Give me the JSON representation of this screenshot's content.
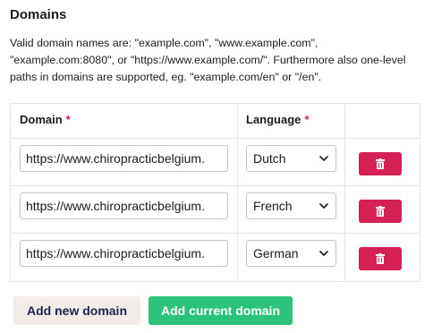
{
  "title": "Domains",
  "help_lines": [
    "Valid domain names are: \"example.com\", \"www.example.com\",",
    "\"example.com:8080\", or \"https://www.example.com/\". Furthermore also one-level",
    "paths in domains are supported, eg. \"example.com/en\" or \"/en\"."
  ],
  "table": {
    "headers": {
      "domain": "Domain",
      "language": "Language",
      "required_marker": "*"
    },
    "rows": [
      {
        "domain": "https://www.chiropracticbelgium.",
        "language": "Dutch"
      },
      {
        "domain": "https://www.chiropracticbelgium.",
        "language": "French"
      },
      {
        "domain": "https://www.chiropracticbelgium.",
        "language": "German"
      }
    ]
  },
  "buttons": {
    "add_new": "Add new domain",
    "add_current": "Add current domain"
  },
  "icons": {
    "delete": "trash-icon",
    "select": "chevron-down-icon"
  },
  "colors": {
    "danger": "#d42054",
    "success": "#2bc37c",
    "secondary": "#f3ece8",
    "text": "#1b264f"
  }
}
